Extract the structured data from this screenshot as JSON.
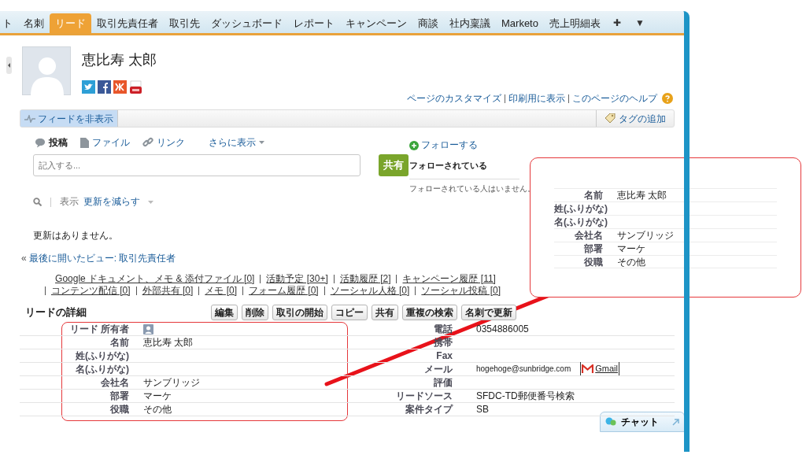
{
  "tabs": [
    {
      "label": "ト",
      "selected": false
    },
    {
      "label": "名刺",
      "selected": false
    },
    {
      "label": "リード",
      "selected": true
    },
    {
      "label": "取引先責任者",
      "selected": false
    },
    {
      "label": "取引先",
      "selected": false
    },
    {
      "label": "ダッシュボード",
      "selected": false
    },
    {
      "label": "レポート",
      "selected": false
    },
    {
      "label": "キャンペーン",
      "selected": false
    },
    {
      "label": "商談",
      "selected": false
    },
    {
      "label": "社内稟議",
      "selected": false
    },
    {
      "label": "Marketo",
      "selected": false
    },
    {
      "label": "売上明細表",
      "selected": false
    }
  ],
  "tab_extras": [
    "✚",
    "▼"
  ],
  "record": {
    "name": "恵比寿 太郎"
  },
  "page_links": [
    "ページのカスタマイズ",
    "印刷用に表示",
    "このページのヘルプ"
  ],
  "feed_bar": {
    "hide_feed": "フィードを非表示",
    "add_tag": "タグの追加"
  },
  "publisher": {
    "tabs": [
      {
        "label": "投稿",
        "kind": "post",
        "selected": true
      },
      {
        "label": "ファイル",
        "kind": "file",
        "selected": false
      },
      {
        "label": "リンク",
        "kind": "link",
        "selected": false
      },
      {
        "label": "さらに表示",
        "kind": "more",
        "selected": false
      }
    ],
    "placeholder": "記入する...",
    "share": "共有"
  },
  "filter": {
    "label": "表示",
    "value": "更新を減らす"
  },
  "no_updates": "更新はありません。",
  "follow": {
    "action": "フォローする",
    "heading": "フォローされている",
    "empty": "フォローされている人はいません。"
  },
  "breadcrumb": {
    "arrow": "«",
    "text": "最後に開いたビュー: 取引先責任者"
  },
  "related_links": [
    "Google ドキュメント、メモ & 添付ファイル [0]",
    "活動予定 [30+]",
    "活動履歴 [2]",
    "キャンペーン履歴 [11]",
    "コンテンツ配信 [0]",
    "外部共有 [0]",
    "メモ [0]",
    "フォーム履歴 [0]",
    "ソーシャル人格 [0]",
    "ソーシャル投稿 [0]"
  ],
  "detail": {
    "title": "リードの詳細",
    "buttons": [
      "編集",
      "削除",
      "取引の開始",
      "コピー",
      "共有",
      "重複の検索",
      "名刺で更新"
    ],
    "left_fields": [
      {
        "label": "リード 所有者",
        "kind": "owner"
      },
      {
        "label": "名前",
        "value": "恵比寿 太郎",
        "kind": "text"
      },
      {
        "label": "姓(ふりがな)",
        "kind": "text"
      },
      {
        "label": "名(ふりがな)",
        "kind": "text"
      },
      {
        "label": "会社名",
        "value": "サンブリッジ",
        "kind": "text"
      },
      {
        "label": "部署",
        "value": "マーケ",
        "kind": "text"
      },
      {
        "label": "役職",
        "value": "その他",
        "kind": "text"
      }
    ],
    "right_fields": [
      {
        "label": "電話",
        "value": "0354886005",
        "kind": "text"
      },
      {
        "label": "携帯",
        "kind": "text"
      },
      {
        "label": "Fax",
        "kind": "text"
      },
      {
        "label": "メール",
        "value": "hogehoge@sunbridge.com",
        "kind": "email",
        "link": "Gmail"
      },
      {
        "label": "評価",
        "kind": "text"
      },
      {
        "label": "リードソース",
        "value": "SFDC-TD郵便番号検索",
        "kind": "text"
      },
      {
        "label": "案件タイプ",
        "value": "SB",
        "kind": "text"
      }
    ]
  },
  "callout": {
    "fields": [
      {
        "label": "名前",
        "value": "恵比寿 太郎"
      },
      {
        "label": "姓(ふりがな)"
      },
      {
        "label": "名(ふりがな)"
      },
      {
        "label": "会社名",
        "value": "サンブリッジ"
      },
      {
        "label": "部署",
        "value": "マーケ"
      },
      {
        "label": "役職",
        "value": "その他"
      }
    ]
  },
  "chat": {
    "label": "チャット"
  }
}
